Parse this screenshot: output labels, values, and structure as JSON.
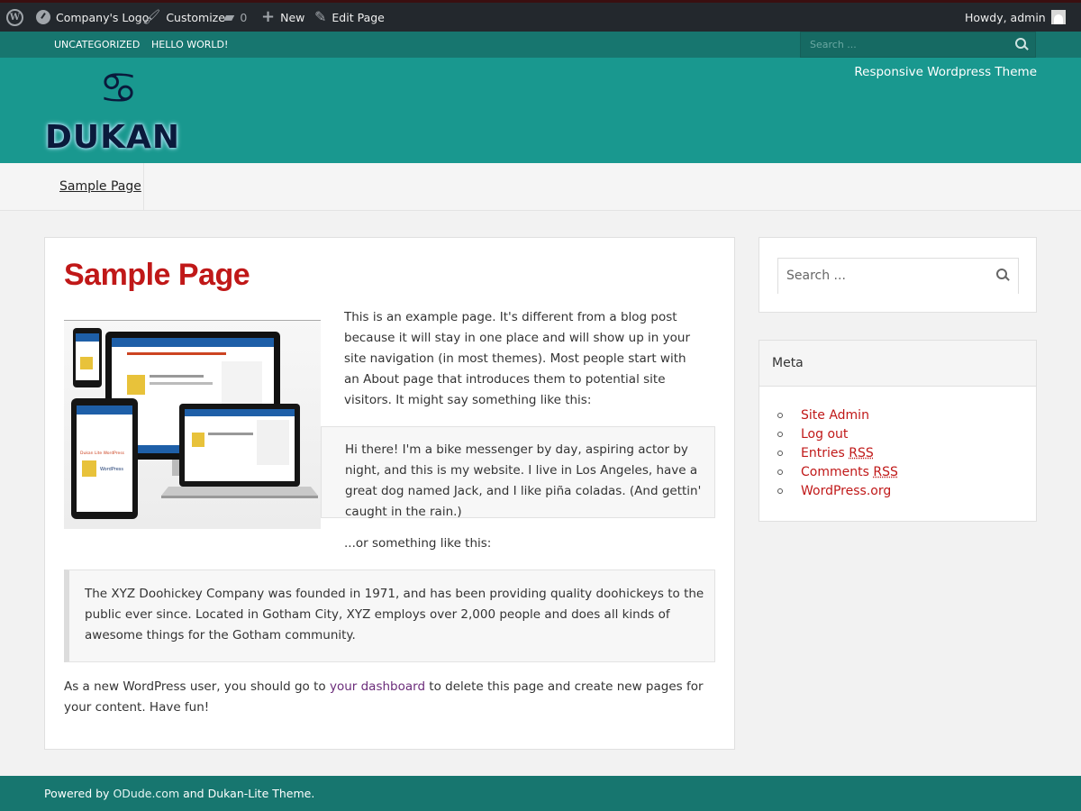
{
  "admin_bar": {
    "logo_label": "Company's Logo",
    "customize_label": "Customize",
    "comments_count": "0",
    "new_label": "New",
    "edit_label": "Edit Page",
    "howdy": "Howdy, admin",
    "icons": [
      "wordpress-icon",
      "dashboard-icon",
      "brush-icon",
      "comment-icon",
      "plus-icon",
      "pencil-icon",
      "avatar-icon"
    ]
  },
  "top_nav": {
    "items": [
      "UNCATEGORIZED",
      "HELLO WORLD!"
    ],
    "search_placeholder": "Search ..."
  },
  "header": {
    "logo_symbol": "♋",
    "logo_text": "DUKAN",
    "tagline": "Responsive Wordpress Theme",
    "colors": {
      "accent": "#19988f",
      "nav": "#17766f",
      "title": "#c01818"
    }
  },
  "main_nav": {
    "items": [
      "Sample Page"
    ]
  },
  "content": {
    "title": "Sample Page",
    "intro": "This is an example page. It's different from a blog post because it will stay in one place and will show up in your site navigation (in most themes). Most people start with an About page that introduces them to potential site visitors. It might say something like this:",
    "quote1": "Hi there! I'm a bike messenger by day, aspiring actor by night, and this is my website. I live in Los Angeles, have a great dog named Jack, and I like piña coladas. (And gettin' caught in the rain.)",
    "or_this": "...or something like this:",
    "quote2": "The XYZ Doohickey Company was founded in 1971, and has been providing quality doohickeys to the public ever since. Located in Gotham City, XYZ employs over 2,000 people and does all kinds of awesome things for the Gotham community.",
    "outro_before": "As a new WordPress user, you should go to ",
    "outro_link": "your dashboard",
    "outro_after": " to delete this page and create new pages for your content. Have fun!",
    "image_texts": {
      "tablet_heading": "Dukan Lite WordPress",
      "brand": "WordPress"
    }
  },
  "sidebar": {
    "search_placeholder": "Search ...",
    "meta_title": "Meta",
    "meta_items": [
      {
        "text": "Site Admin",
        "abbr": ""
      },
      {
        "text": "Log out",
        "abbr": ""
      },
      {
        "text": "Entries ",
        "abbr": "RSS"
      },
      {
        "text": "Comments ",
        "abbr": "RSS"
      },
      {
        "text": "WordPress.org",
        "abbr": ""
      }
    ]
  },
  "footer": {
    "prefix": "Powered by ",
    "link": "ODude.com",
    "suffix": " and Dukan-Lite Theme."
  }
}
